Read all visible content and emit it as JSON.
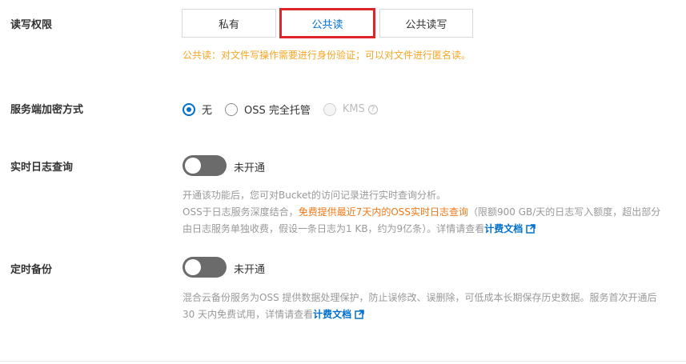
{
  "acl": {
    "label": "读写权限",
    "options": [
      "私有",
      "公共读",
      "公共读写"
    ],
    "selected": "公共读",
    "hint": "公共读：对文件写操作需要进行身份验证；可以对文件进行匿名读。"
  },
  "encryption": {
    "label": "服务端加密方式",
    "options": [
      {
        "label": "无",
        "checked": true,
        "disabled": false
      },
      {
        "label": "OSS 完全托管",
        "checked": false,
        "disabled": false
      },
      {
        "label": "KMS",
        "checked": false,
        "disabled": true
      }
    ],
    "help_icon": "question-circle-icon"
  },
  "realtime_log": {
    "label": "实时日志查询",
    "switch_on": false,
    "status": "未开通",
    "desc_line1": "开通该功能后，您可对Bucket的访问记录进行实时查询分析。",
    "desc_line2_prefix": "OSS于日志服务深度结合，",
    "desc_line2_highlight": "免费提供最近7天内的OSS实时日志查询",
    "desc_line2_suffix": "（限额900 GB/天的日志写入额度，超出部分由日志服务单独收费，假设一条日志为1 KB，约为9亿条）。详情请查看",
    "link": "计费文档",
    "link_icon": "external-link-icon"
  },
  "backup": {
    "label": "定时备份",
    "switch_on": false,
    "status": "未开通",
    "desc_prefix": "混合云备份服务为OSS 提供数据处理保护，防止误修改、误删除，可低成本长期保存历史数据。服务首次开通后 30 天内免费试用，详情请查看",
    "link": "计费文档",
    "link_icon": "external-link-icon"
  },
  "colors": {
    "accent": "#0070cc",
    "selected_border": "#e0242b",
    "warning": "#f5a623",
    "highlight": "#f07818",
    "switch_off": "#6b6b6b"
  }
}
